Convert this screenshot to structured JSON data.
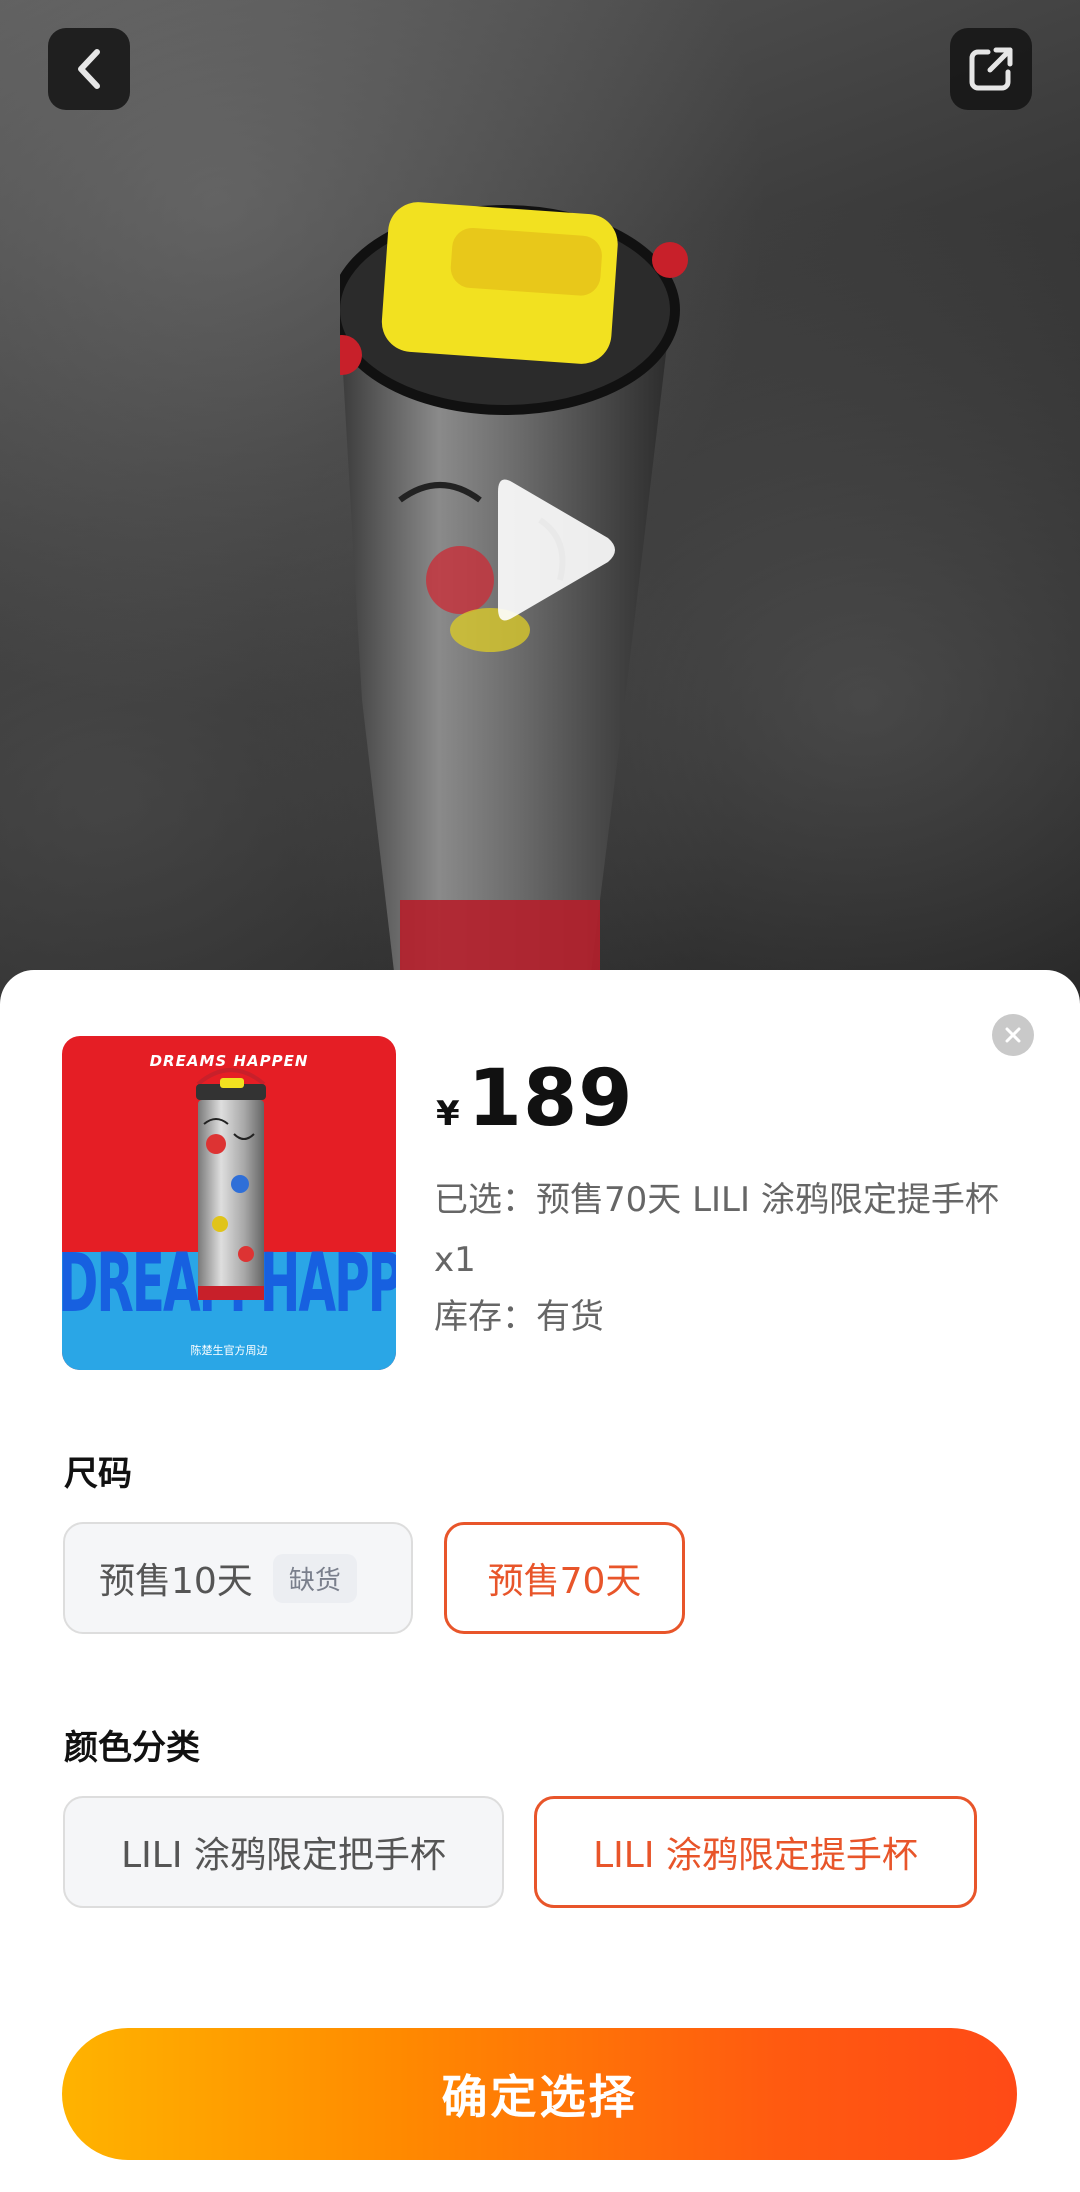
{
  "header": {
    "back_icon": "chevron-left-icon",
    "share_icon": "share-icon"
  },
  "video": {
    "play_icon": "play-icon"
  },
  "product": {
    "thumbnail": {
      "brand_text": "DREAMS HAPPEN",
      "big_text": "DREAM HAPPEN",
      "footer_text": "陈楚生官方周边"
    },
    "price_symbol": "¥",
    "price": "189",
    "selected_text": "已选：预售70天 LILI 涂鸦限定提手杯 x1",
    "stock_text": "库存：有货"
  },
  "size_section": {
    "label": "尺码",
    "options": [
      {
        "label": "预售10天",
        "badge": "缺货",
        "selected": false
      },
      {
        "label": "预售70天",
        "selected": true
      }
    ]
  },
  "color_section": {
    "label": "颜色分类",
    "options": [
      {
        "label": "LILI 涂鸦限定把手杯",
        "selected": false
      },
      {
        "label": "LILI 涂鸦限定提手杯",
        "selected": true
      }
    ]
  },
  "confirm": {
    "label": "确定选择"
  },
  "colors": {
    "accent": "#e8552a",
    "button_start": "#ffb300",
    "button_end": "#ff4a16",
    "thumb_red": "#e51e25",
    "thumb_blue": "#2aa6e6"
  }
}
